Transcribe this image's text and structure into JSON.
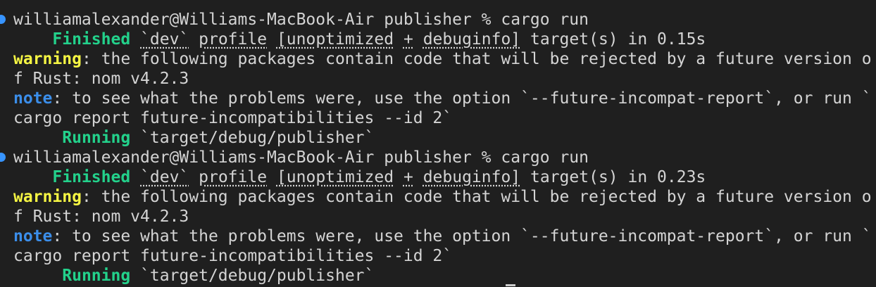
{
  "runs": [
    {
      "prompt": "williamalexander@Williams-MacBook-Air publisher % cargo run",
      "finished_label": "Finished",
      "finished_profile_a": "`dev`",
      "finished_profile_b": "profile",
      "finished_profile_c": "[unoptimized",
      "finished_profile_d": "+",
      "finished_profile_e": "debuginfo]",
      "finished_rest": " target(s) in 0.15s",
      "warning_label": "warning",
      "warning_text": ": the following packages contain code that will be rejected by a future version o",
      "warning_wrap": "f Rust: nom v4.2.3",
      "note_label": "note",
      "note_text": ": to see what the problems were, use the option `--future-incompat-report`, or run `",
      "note_wrap": "cargo report future-incompatibilities --id 2`",
      "running_label": "Running",
      "running_text": " `target/debug/publisher`"
    },
    {
      "prompt": "williamalexander@Williams-MacBook-Air publisher % cargo run",
      "finished_label": "Finished",
      "finished_profile_a": "`dev`",
      "finished_profile_b": "profile",
      "finished_profile_c": "[unoptimized",
      "finished_profile_d": "+",
      "finished_profile_e": "debuginfo]",
      "finished_rest": " target(s) in 0.23s",
      "warning_label": "warning",
      "warning_text": ": the following packages contain code that will be rejected by a future version o",
      "warning_wrap": "f Rust: nom v4.2.3",
      "note_label": "note",
      "note_text": ": to see what the problems were, use the option `--future-incompat-report`, or run `",
      "note_wrap": "cargo report future-incompatibilities --id 2`",
      "running_label": "Running",
      "running_text": " `target/debug/publisher`"
    }
  ],
  "colors": {
    "background": "#1f1f1f",
    "text": "#d4d4d4",
    "finished_running": "#23d18b",
    "warning": "#f5f543",
    "note": "#3b8eea",
    "command_marker": "#3794ff"
  }
}
